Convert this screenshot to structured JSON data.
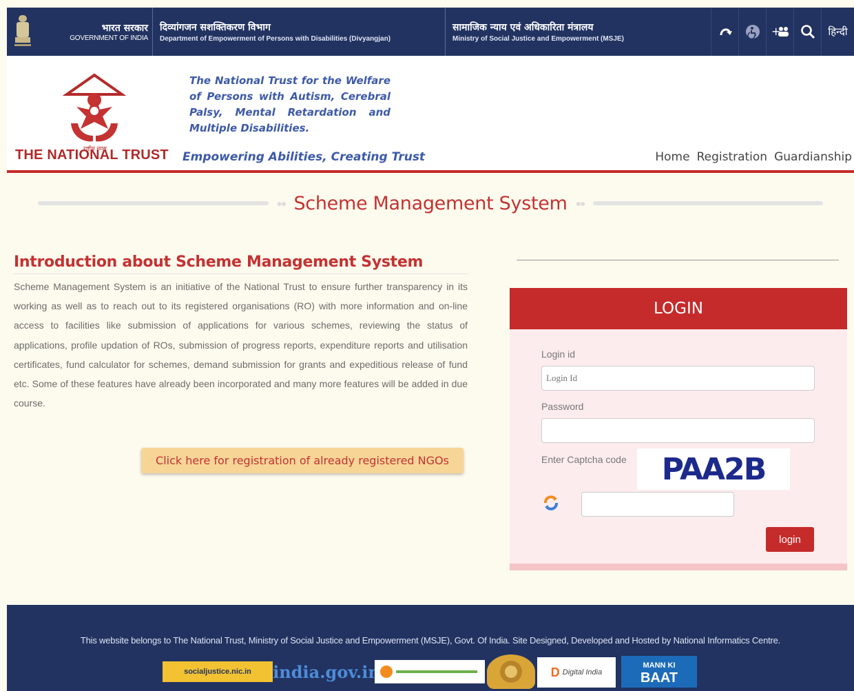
{
  "gov": {
    "hindi": "भारत सरकार",
    "english": "GOVERNMENT OF INDIA"
  },
  "department": {
    "hindi": "दिव्यांगजन सशक्तिकरण विभाग",
    "english": "Department of Empowerment of Persons with Disabilities (Divyangjan)"
  },
  "ministry": {
    "hindi": "सामाजिक न्याय एवं अधिकारिता मंत्रालय",
    "english": "Ministry of Social Justice and Empowerment (MSJE)"
  },
  "toolbar": {
    "hindi_label": "हिन्दी"
  },
  "header": {
    "brand": "THE NATIONAL TRUST",
    "tagline_top": "The National Trust for the Welfare of Persons with Autism, Cerebral Palsy, Mental Retardation and Multiple Disabilities.",
    "tagline_bottom": "Empowering Abilities, Creating Trust",
    "nav": [
      "Home",
      "Registration",
      "Guardianship"
    ]
  },
  "page_title": "Scheme Management System",
  "intro": {
    "title": "Introduction about Scheme Management System",
    "body": "Scheme Management System is an initiative of the National Trust to ensure further transparency in its working as well as to reach out to its registered organisations (RO) with more information and on-line access to facilities like submission of applications for various schemes, reviewing the status of applications, profile updation of ROs, submission of progress reports, expenditure reports and utilisation certificates, fund calculator for schemes, demand submission for grants and expeditious release of fund etc. Some of these features have already been incorporated and many more features will be added in due course.",
    "register_button": "Click here for registration of already registered NGOs"
  },
  "login": {
    "heading": "LOGIN",
    "login_id_label": "Login id",
    "login_id_placeholder": "Login Id",
    "login_id_value": "",
    "password_label": "Password",
    "password_value": "",
    "captcha_label": "Enter Captcha code",
    "captcha_text": "PAA2B",
    "captcha_value": "",
    "submit_label": "login"
  },
  "footer": {
    "text": "This website belongs to The National Trust, Ministry of Social Justice and Empowerment (MSJE), Govt. Of India. Site Designed, Developed and Hosted by National Informatics Centre.",
    "logos": {
      "social_justice": "socialjustice.nic.in",
      "india_gov": "india.gov.in",
      "digital_india": "Digital India",
      "mkb_top": "MANN KI",
      "mkb_bottom": "BAAT"
    }
  },
  "colors": {
    "navy": "#223361",
    "accent_red": "#c52b2b",
    "tagline_blue": "#3d5aa8",
    "button_gold": "#f6d597"
  }
}
